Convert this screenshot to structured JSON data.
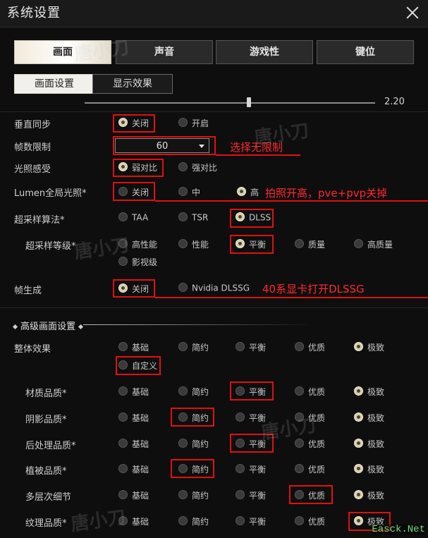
{
  "window": {
    "title": "系统设置"
  },
  "main_tabs": [
    "画面",
    "声音",
    "游戏性",
    "键位"
  ],
  "sub_tabs": [
    "画面设置",
    "显示效果"
  ],
  "brightness_slider": {
    "value": "2.20",
    "level": 0.56
  },
  "settings": {
    "vsync": {
      "label": "垂直同步",
      "options": [
        "关闭",
        "开启"
      ],
      "selected": 0
    },
    "fps_limit": {
      "label": "帧数限制",
      "value": "60"
    },
    "light": {
      "label": "光照感受",
      "options": [
        "弱对比",
        "强对比"
      ],
      "selected": 0
    },
    "lumen": {
      "label": "Lumen全局光照*",
      "options": [
        "关闭",
        "中",
        "高"
      ],
      "selected": 2
    },
    "upscale": {
      "label": "超采样算法*",
      "options": [
        "TAA",
        "TSR",
        "DLSS"
      ],
      "selected": 2
    },
    "upscale_quality": {
      "label": "超采样等级*",
      "options": [
        "高性能",
        "性能",
        "平衡",
        "质量",
        "高质量",
        "影视级"
      ],
      "selected": 2
    },
    "frame_gen": {
      "label": "帧生成",
      "options": [
        "关闭",
        "Nvidia DLSSG"
      ],
      "selected": 0
    }
  },
  "advanced": {
    "title": "高级画面设置",
    "levels": [
      "基础",
      "简约",
      "平衡",
      "优质",
      "极致"
    ],
    "overall": {
      "label": "整体效果",
      "selected": 4,
      "custom_label": "自定义"
    },
    "rows": [
      {
        "label": "材质品质*",
        "selected": 4
      },
      {
        "label": "阴影品质*",
        "selected": 4
      },
      {
        "label": "后处理品质*",
        "selected": 4
      },
      {
        "label": "植被品质*",
        "selected": 4
      },
      {
        "label": "多层次细节",
        "selected": 4
      },
      {
        "label": "纹理品质*",
        "selected": 4
      }
    ]
  },
  "annotations": {
    "fps": "选择无限制",
    "lumen": "拍照开高，pve+pvp关掉",
    "frame_gen": "40系显卡打开DLSSG"
  },
  "watermark": "唐小刀",
  "brand": "Easck.Net",
  "colors": {
    "annotation_red": "#e01010",
    "selected_radio": "#d8d1b0"
  }
}
